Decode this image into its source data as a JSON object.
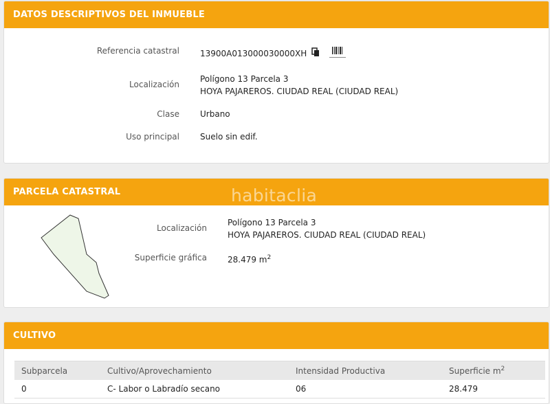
{
  "datos": {
    "title": "DATOS DESCRIPTIVOS DEL INMUEBLE",
    "referencia_label": "Referencia catastral",
    "referencia_value": "13900A013000030000XH",
    "localizacion_label": "Localización",
    "localizacion_line1": "Polígono 13 Parcela 3",
    "localizacion_line2": "HOYA PAJAREROS. CIUDAD REAL (CIUDAD REAL)",
    "clase_label": "Clase",
    "clase_value": "Urbano",
    "uso_label": "Uso principal",
    "uso_value": "Suelo sin edif."
  },
  "parcela": {
    "title": "PARCELA CATASTRAL",
    "localizacion_label": "Localización",
    "localizacion_line1": "Polígono 13 Parcela 3",
    "localizacion_line2": "HOYA PAJAREROS. CIUDAD REAL (CIUDAD REAL)",
    "superficie_label": "Superficie gráfica",
    "superficie_value": "28.479 m",
    "superficie_unit_sup": "2"
  },
  "watermark": "habitaclia",
  "cultivo": {
    "title": "CULTIVO",
    "headers": [
      "Subparcela",
      "Cultivo/Aprovechamiento",
      "Intensidad Productiva",
      "Superficie m"
    ],
    "header_sup": "2",
    "rows": [
      [
        "0",
        "C- Labor o Labradío secano",
        "06",
        "28.479"
      ]
    ]
  },
  "icons": {
    "copy": "copy-icon",
    "barcode": "barcode-icon"
  },
  "colors": {
    "header": "#f5a40f",
    "parcel_fill": "#eef6e8"
  }
}
